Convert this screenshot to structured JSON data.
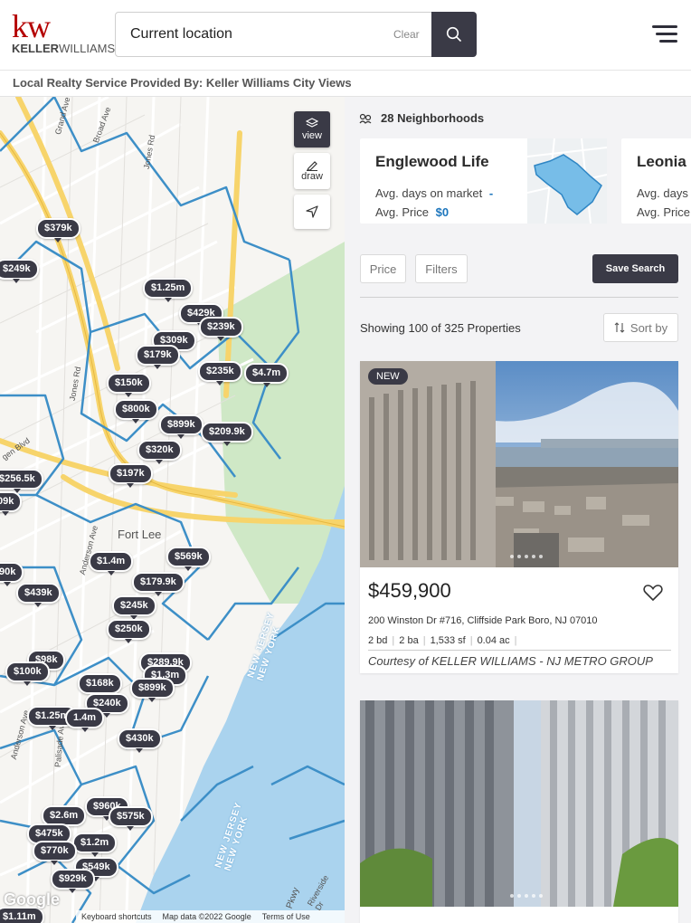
{
  "header": {
    "logo_mark": "kw",
    "logo_name_bold": "KELLER",
    "logo_name_rest": "WILLIAMS.",
    "search_value": "Current location",
    "clear_label": "Clear"
  },
  "provider_text": "Local Realty Service Provided By: Keller Williams City Views",
  "map": {
    "controls": {
      "view": "view",
      "draw": "draw"
    },
    "labels": {
      "fort_lee": "Fort Lee",
      "nj_ny_1": "NEW JERSEY NEW YORK",
      "nj_ny_2": "NEW JERSEY NEW YORK",
      "parkway": "Pkwy",
      "riverside": "Riverside Dr",
      "grand_ave": "Grand Ave",
      "broad_ave": "Broad Ave",
      "jones_rd_1": "Jones Rd",
      "jones_rd_2": "Jones Rd",
      "anderson_ave_1": "Anderson Ave",
      "anderson_ave_2": "Anderson Ave",
      "palisade_ave": "Palisade Ave",
      "bergen_blvd": "gen Blvd"
    },
    "google": "Google",
    "footer": {
      "shortcuts": "Keyboard shortcuts",
      "mapdata": "Map data ©2022 Google",
      "terms": "Terms of Use"
    },
    "pins": [
      "$379k",
      "$249k",
      "$1.25m",
      "$429k",
      "$239k",
      "$309k",
      "$179k",
      "$235k",
      "$4.7m",
      "$150k",
      "$800k",
      "$899k",
      "$209.9k",
      "$320k",
      "$197k",
      "$256.5k",
      "09k",
      "$1.4m",
      "$569k",
      "$179.9k",
      "$245k",
      "$250k",
      "90k",
      "$439k",
      "$98k",
      "$289.9k",
      "$100k",
      "$1.3m",
      "$168k",
      "$899k",
      "$240k",
      "$1.25m",
      "1.4m",
      "$430k",
      "$960k",
      "$2.6m",
      "$575k",
      "$475k",
      "$1.2m",
      "$770k",
      "$549k",
      "$929k",
      "$1.11m"
    ]
  },
  "neighborhoods": {
    "count_label": "28 Neighborhoods",
    "cards": [
      {
        "name": "Englewood Life",
        "days_label": "Avg. days on market",
        "days_value": "-",
        "price_label": "Avg. Price",
        "price_value": "$0"
      },
      {
        "name": "Leonia",
        "days_label": "Avg. days o",
        "price_label": "Avg. Price"
      }
    ]
  },
  "filters": {
    "price": "Price",
    "filters": "Filters",
    "save": "Save Search"
  },
  "results": {
    "showing": "Showing 100 of 325 Properties",
    "sort": "Sort by"
  },
  "listings": [
    {
      "badge": "NEW",
      "price": "$459,900",
      "address": "200 Winston Dr #716, Cliffside Park Boro, NJ 07010",
      "beds": "2 bd",
      "baths": "2 ba",
      "sqft": "1,533 sf",
      "acres": "0.04 ac",
      "courtesy": "Courtesy of KELLER WILLIAMS - NJ METRO GROUP"
    },
    {
      "badge": "",
      "price": "",
      "address": "",
      "beds": "",
      "baths": "",
      "sqft": "",
      "acres": "",
      "courtesy": ""
    }
  ],
  "colors": {
    "brand_red": "#b40101",
    "dark": "#3a3a46",
    "link_blue": "#1c75bc",
    "water": "#aad3ee",
    "boundary": "#3d8fc7",
    "road": "#f7d46b"
  }
}
